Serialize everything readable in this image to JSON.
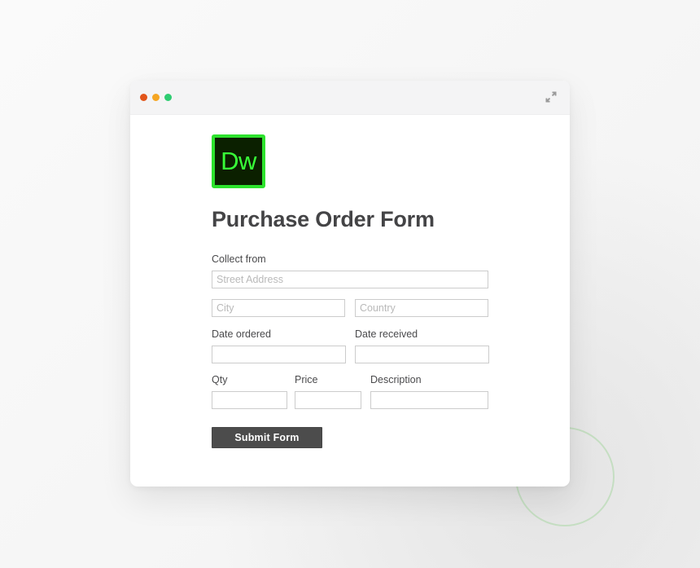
{
  "window": {
    "titlebar": {
      "dots": [
        {
          "name": "close",
          "color": "#e2551b"
        },
        {
          "name": "minimize",
          "color": "#f5a623"
        },
        {
          "name": "maximize",
          "color": "#2ecc71"
        }
      ],
      "expand_icon": "expand-diagonal-icon"
    }
  },
  "brand": {
    "logo_text": "Dw",
    "logo_bg": "#0b2000",
    "logo_border": "#2de22d",
    "logo_fg": "#38ff38"
  },
  "form": {
    "title": "Purchase Order Form",
    "labels": {
      "collect_from": "Collect from",
      "date_ordered": "Date ordered",
      "date_received": "Date received",
      "qty": "Qty",
      "price": "Price",
      "description": "Description"
    },
    "fields": {
      "street": {
        "placeholder": "Street Address",
        "value": ""
      },
      "city": {
        "placeholder": "City",
        "value": ""
      },
      "country": {
        "placeholder": "Country",
        "value": ""
      },
      "date_ordered": {
        "placeholder": "",
        "value": ""
      },
      "date_received": {
        "placeholder": "",
        "value": ""
      },
      "qty": {
        "placeholder": "",
        "value": ""
      },
      "price": {
        "placeholder": "",
        "value": ""
      },
      "description": {
        "placeholder": "",
        "value": ""
      }
    },
    "submit_label": "Submit Form",
    "submit_bg": "#4c4c4c"
  },
  "decor": {
    "ring_color": "#c3ddc0"
  }
}
